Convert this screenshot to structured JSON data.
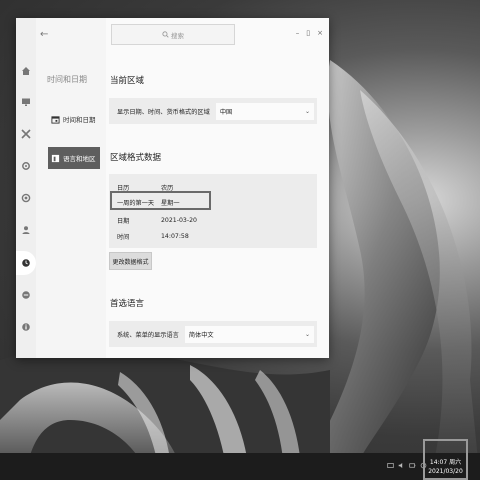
{
  "window": {
    "search_placeholder": "搜索",
    "controls": {
      "minimize": "–",
      "maximize": "▯",
      "close": "×"
    }
  },
  "sidebar": {
    "heading": "时间和日期",
    "items": [
      {
        "label": "时间和日期",
        "icon": "calendar-icon",
        "selected": false
      },
      {
        "label": "语言和地区",
        "icon": "language-icon",
        "selected": true
      }
    ]
  },
  "nav_icons": [
    "home-icon",
    "display-icon",
    "tools-icon",
    "settings-icon",
    "apps-icon",
    "account-icon",
    "clock-icon",
    "update-icon",
    "info-icon"
  ],
  "current_region": {
    "title": "当前区域",
    "label": "显示日期、时间、货币格式的区域",
    "value": "中国"
  },
  "region_format": {
    "title": "区域格式数据",
    "rows": [
      {
        "label": "日历",
        "value": "农历"
      },
      {
        "label": "一周的第一天",
        "value": "星期一"
      },
      {
        "label": "日期",
        "value": "2021-03-20"
      },
      {
        "label": "时间",
        "value": "14:07:58"
      }
    ],
    "change_button": "更改数据格式"
  },
  "preferred_language": {
    "title": "首选语言",
    "label": "系统、菜单的显示语言",
    "value": "简体中文"
  },
  "taskbar": {
    "clock_time": "14:07 周六",
    "clock_date": "2021/03/20"
  }
}
